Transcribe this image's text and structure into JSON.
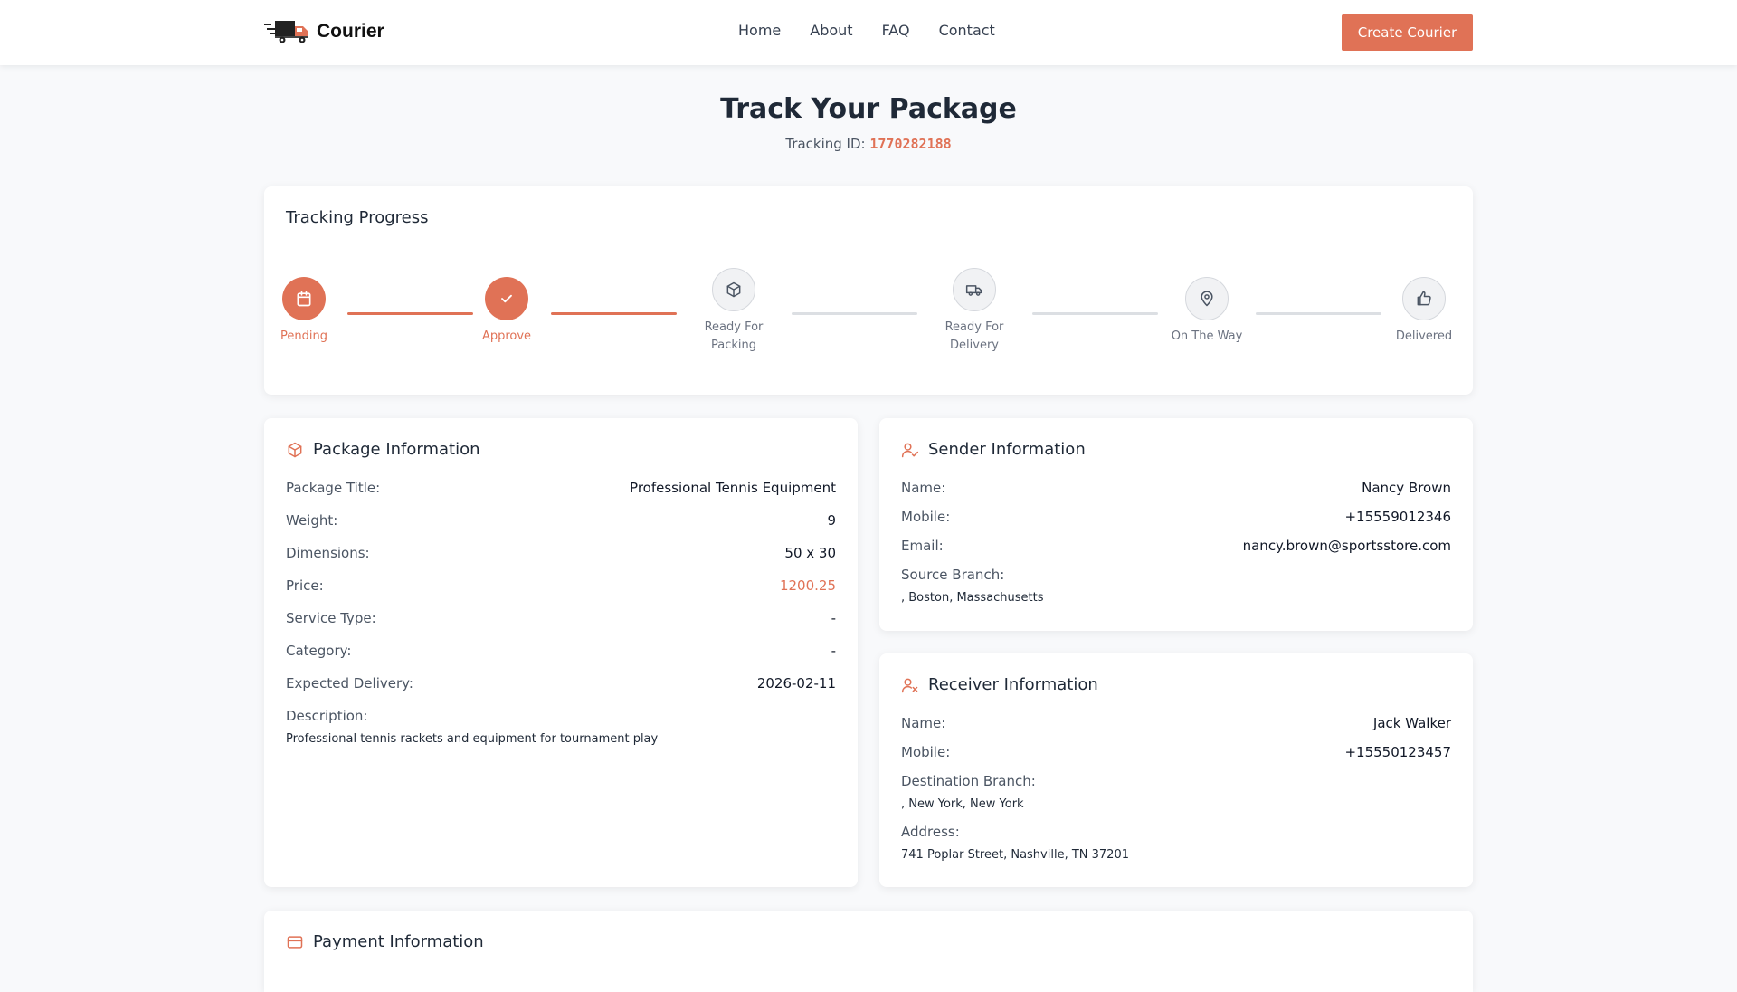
{
  "header": {
    "logo_text": "Courier",
    "nav": [
      "Home",
      "About",
      "FAQ",
      "Contact"
    ],
    "create_button": "Create Courier"
  },
  "page": {
    "title": "Track Your Package",
    "tracking_label": "Tracking ID:",
    "tracking_id": "1770282188"
  },
  "progress": {
    "title": "Tracking Progress",
    "steps": [
      {
        "label_lines": [
          "Pending"
        ],
        "icon": "calendar-icon",
        "done": true
      },
      {
        "label_lines": [
          "Approve"
        ],
        "icon": "check-icon",
        "done": true
      },
      {
        "label_lines": [
          "Ready For",
          "Packing"
        ],
        "icon": "box-icon",
        "done": false
      },
      {
        "label_lines": [
          "Ready For",
          "Delivery"
        ],
        "icon": "truck-icon",
        "done": false
      },
      {
        "label_lines": [
          "On The Way"
        ],
        "icon": "map-pin-icon",
        "done": false
      },
      {
        "label_lines": [
          "Delivered"
        ],
        "icon": "thumbs-up-icon",
        "done": false
      }
    ]
  },
  "package": {
    "title": "Package Information",
    "rows": [
      {
        "label": "Package Title:",
        "value": "Professional Tennis Equipment"
      },
      {
        "label": "Weight:",
        "value": "9"
      },
      {
        "label": "Dimensions:",
        "value": "50 x 30"
      },
      {
        "label": "Price:",
        "value": "1200.25"
      },
      {
        "label": "Service Type:",
        "value": "-"
      },
      {
        "label": "Category:",
        "value": "-"
      },
      {
        "label": "Expected Delivery:",
        "value": "2026-02-11"
      }
    ],
    "description_label": "Description:",
    "description": "Professional tennis rackets and equipment for tournament play"
  },
  "sender": {
    "title": "Sender Information",
    "rows": [
      {
        "label": "Name:",
        "value": "Nancy Brown"
      },
      {
        "label": "Mobile:",
        "value": "+15559012346"
      },
      {
        "label": "Email:",
        "value": "nancy.brown@sportsstore.com"
      }
    ],
    "branch_label": "Source Branch:",
    "branch": ", Boston, Massachusetts"
  },
  "receiver": {
    "title": "Receiver Information",
    "rows": [
      {
        "label": "Name:",
        "value": "Jack Walker"
      },
      {
        "label": "Mobile:",
        "value": "+15550123457"
      }
    ],
    "branch_label": "Destination Branch:",
    "branch": ", New York, New York",
    "address_label": "Address:",
    "address": "741 Poplar Street, Nashville, TN 37201"
  },
  "payment": {
    "title": "Payment Information"
  },
  "colors": {
    "accent": "#e07256",
    "background": "#f8f9fb",
    "inactive": "#dcdfe3"
  }
}
